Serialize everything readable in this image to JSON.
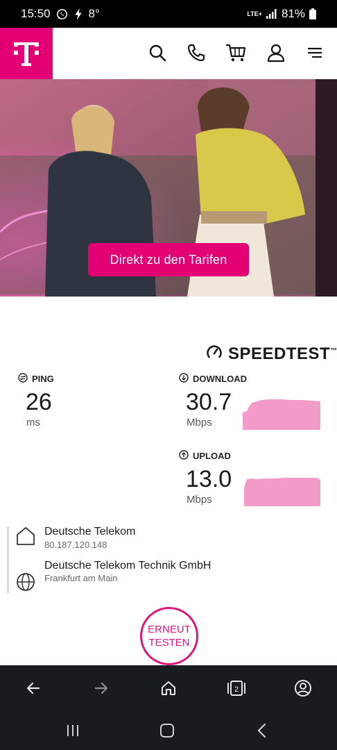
{
  "status_bar": {
    "time": "15:50",
    "temperature": "8°",
    "network": "LTE+",
    "battery": "81%"
  },
  "header": {
    "logo_letter": "T",
    "icons": [
      "search-icon",
      "phone-icon",
      "cart-icon",
      "user-icon",
      "menu-icon"
    ]
  },
  "hero": {
    "cta_label": "Direkt zu den Tarifen",
    "brand_color": "#e20074"
  },
  "speedtest": {
    "logo_text": "SPEEDTEST",
    "trademark": "™",
    "ping": {
      "label": "PING",
      "value": "26",
      "unit": "ms"
    },
    "download": {
      "label": "DOWNLOAD",
      "value": "30.7",
      "unit": "Mbps",
      "graph_color": "#f29ac8"
    },
    "upload": {
      "label": "UPLOAD",
      "value": "13.0",
      "unit": "Mbps",
      "graph_color": "#f29ac8"
    }
  },
  "server": {
    "isp_name": "Deutsche Telekom",
    "isp_ip": "80.187.120.148",
    "host_name": "Deutsche Telekom Technik GmbH",
    "host_location": "Frankfurt am Main"
  },
  "retest": {
    "line1": "ERNEUT",
    "line2": "TESTEN",
    "color": "#e0157a"
  },
  "browser_toolbar": {
    "tab_count": "2",
    "icons": [
      "back-icon",
      "forward-icon",
      "home-icon",
      "tabs-icon",
      "profile-icon"
    ]
  },
  "system_nav": {
    "icons": [
      "recent-apps-icon",
      "home-nav-icon",
      "back-nav-icon"
    ]
  }
}
